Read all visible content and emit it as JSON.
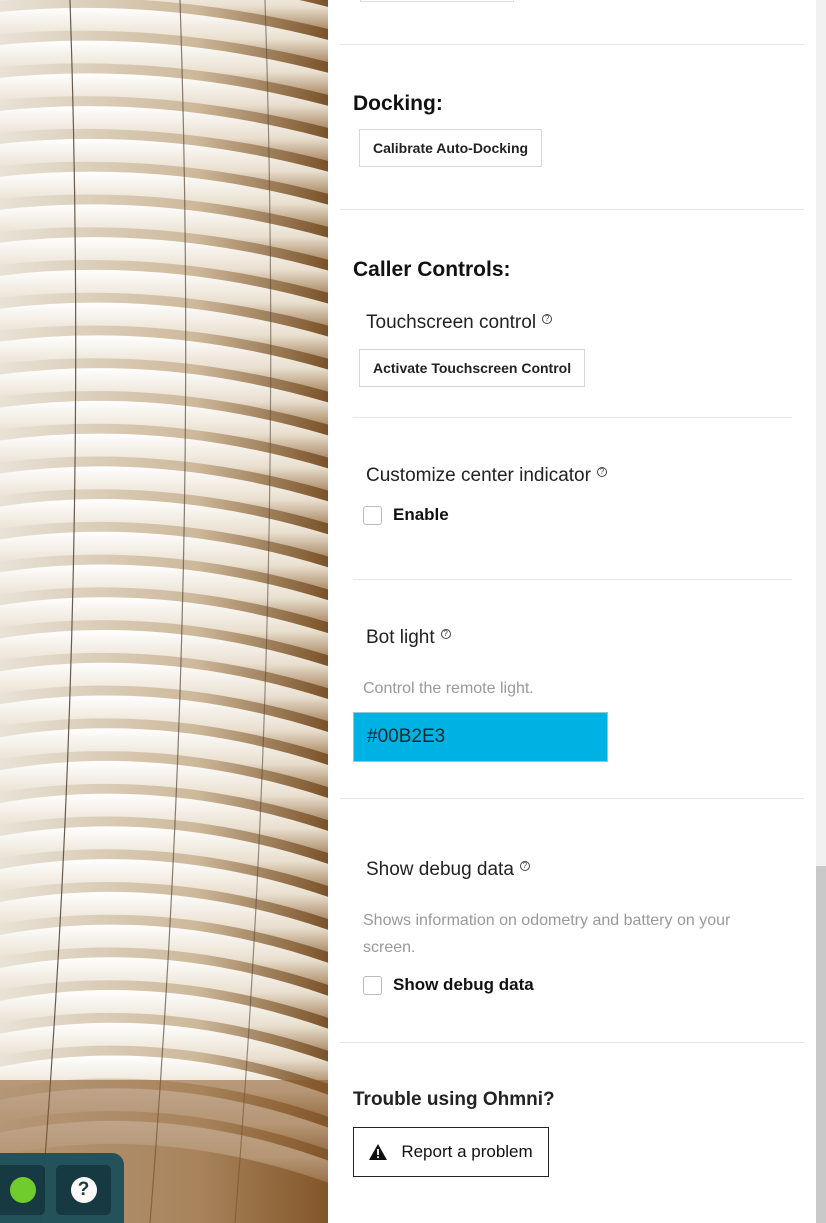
{
  "docking": {
    "title": "Docking:",
    "calibrate_button": "Calibrate Auto-Docking"
  },
  "caller_controls": {
    "title": "Caller Controls:",
    "touchscreen": {
      "label": "Touchscreen control",
      "button": "Activate Touchscreen Control"
    },
    "center_indicator": {
      "label": "Customize center indicator",
      "checkbox_label": "Enable"
    },
    "bot_light": {
      "label": "Bot light",
      "description": "Control the remote light.",
      "color_value": "#00B2E3"
    },
    "debug": {
      "label": "Show debug data",
      "description_line1": "Shows information on odometry and battery on your",
      "description_line2": "screen.",
      "checkbox_label": "Show debug data"
    }
  },
  "trouble": {
    "title": "Trouble using Ohmni?",
    "report_button": "Report a problem"
  },
  "icons": {
    "status": "status-dot-icon",
    "help": "help-icon",
    "warning": "warning-icon",
    "question": "question-icon"
  },
  "colors": {
    "status_online": "#6dcf2a",
    "light_color": "#00B2E3",
    "controls_bg": "#1d4f5a"
  }
}
